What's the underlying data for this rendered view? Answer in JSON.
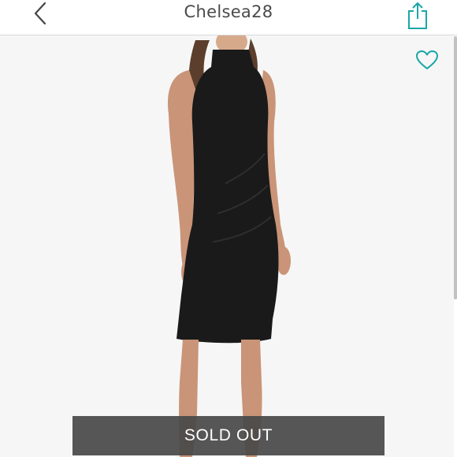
{
  "header": {
    "title": "Chelsea28",
    "back_icon": "chevron-left-icon",
    "share_icon": "share-icon"
  },
  "listing": {
    "favorite_icon": "heart-icon",
    "status_label": "SOLD OUT"
  },
  "colors": {
    "accent": "#1aa6a8",
    "title_text": "#4a4a4a",
    "banner_bg": "#484848"
  }
}
